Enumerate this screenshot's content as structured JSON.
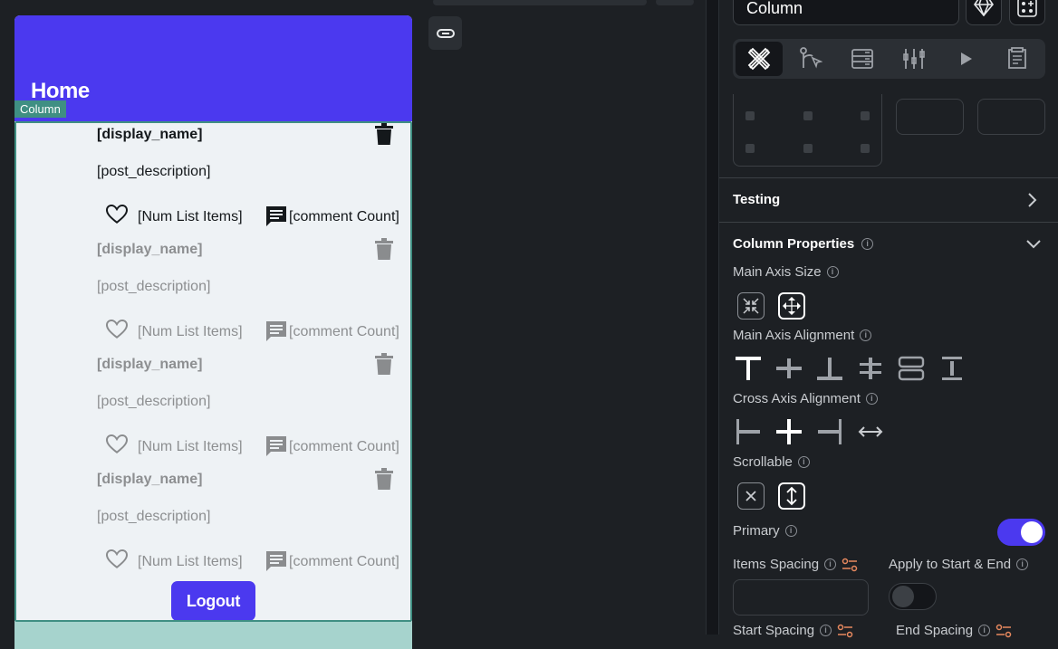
{
  "canvas": {
    "appbar_title": "Home",
    "column_tag": "Column",
    "posts": [
      {
        "display_name": "[display_name]",
        "description": "[post_description]",
        "num_items": "[Num List Items]",
        "comment_count": "[comment Count]"
      },
      {
        "display_name": "[display_name]",
        "description": "[post_description]",
        "num_items": "[Num List Items]",
        "comment_count": "[comment Count]"
      },
      {
        "display_name": "[display_name]",
        "description": "[post_description]",
        "num_items": "[Num List Items]",
        "comment_count": "[comment Count]"
      },
      {
        "display_name": "[display_name]",
        "description": "[post_description]",
        "num_items": "[Num List Items]",
        "comment_count": "[comment Count]"
      }
    ],
    "logout_label": "Logout",
    "brand_color": "#4b39ef",
    "selection_color": "#3f8f83"
  },
  "panel": {
    "widget_name": "Column",
    "tabs": [
      "properties",
      "actions",
      "backend-query",
      "layout",
      "run",
      "notes"
    ],
    "testing_title": "Testing",
    "column_properties_title": "Column Properties",
    "main_axis_size_label": "Main Axis Size",
    "main_axis_alignment_label": "Main Axis Alignment",
    "cross_axis_alignment_label": "Cross Axis Alignment",
    "scrollable_label": "Scrollable",
    "primary_label": "Primary",
    "primary_on": true,
    "items_spacing_label": "Items Spacing",
    "apply_start_end_label": "Apply to Start & End",
    "apply_start_end_on": false,
    "start_spacing_label": "Start Spacing",
    "end_spacing_label": "End Spacing"
  }
}
